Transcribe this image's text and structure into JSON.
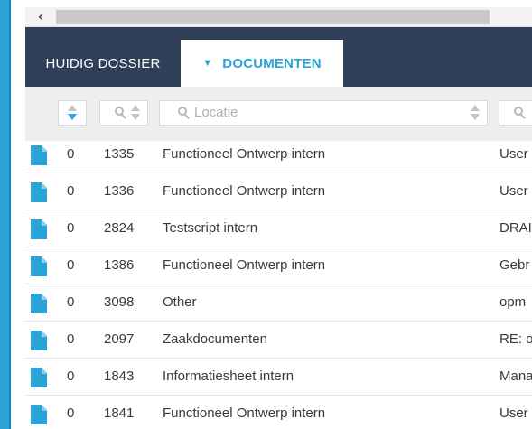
{
  "scrollbar": {
    "left_arrow": "‹"
  },
  "tabs": {
    "huidig": "HUIDIG DOSSIER",
    "documenten": "DOCUMENTEN",
    "documenten_caret": "▼"
  },
  "filters": {
    "location_placeholder": "Locatie"
  },
  "colors": {
    "accent": "#2aa3d6",
    "tabbar": "#2e3f57"
  },
  "rows": [
    {
      "count": "0",
      "number": "1335",
      "type": "Functioneel Ontwerp intern",
      "extra": "User"
    },
    {
      "count": "0",
      "number": "1336",
      "type": "Functioneel Ontwerp intern",
      "extra": "User"
    },
    {
      "count": "0",
      "number": "2824",
      "type": "Testscript intern",
      "extra": "DRAI"
    },
    {
      "count": "0",
      "number": "1386",
      "type": "Functioneel Ontwerp intern",
      "extra": "Gebr"
    },
    {
      "count": "0",
      "number": "3098",
      "type": "Other",
      "extra": "opm"
    },
    {
      "count": "0",
      "number": "2097",
      "type": "Zaakdocumenten",
      "extra": "RE: o"
    },
    {
      "count": "0",
      "number": "1843",
      "type": "Informatiesheet intern",
      "extra": "Mana"
    },
    {
      "count": "0",
      "number": "1841",
      "type": "Functioneel Ontwerp intern",
      "extra": "User"
    }
  ]
}
